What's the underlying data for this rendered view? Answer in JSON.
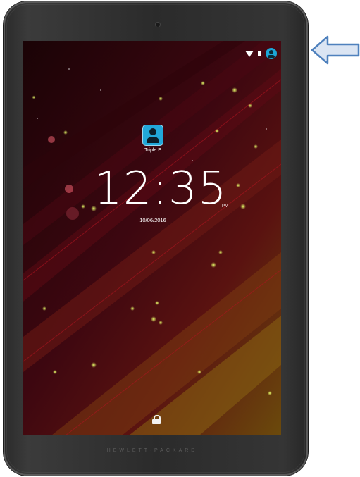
{
  "device": {
    "brand": "HEWLETT-PACKARD"
  },
  "status_bar": {
    "icons": [
      "wifi-icon",
      "battery-icon",
      "user-switcher-icon"
    ],
    "accent_color": "#1ba7d8"
  },
  "lockscreen": {
    "user_name": "Triple E",
    "time": "12:35",
    "ampm": "PM",
    "date": "10/06/2016",
    "unlock_icon": "lock-icon"
  },
  "annotation": {
    "arrow_icon": "left-arrow-icon",
    "arrow_color": "#4f81bd"
  }
}
